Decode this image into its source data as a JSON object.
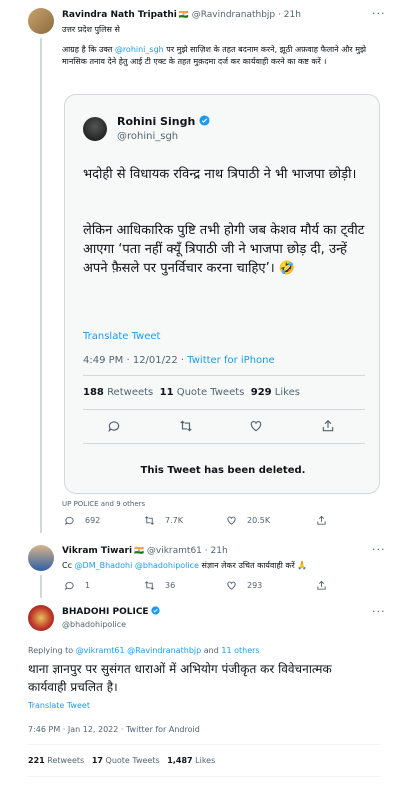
{
  "tweet1": {
    "author": "Ravindra Nath Tripathi",
    "flag": "🇮🇳",
    "handle": "@Ravindranathbjp",
    "time": "· 21h",
    "reply_to": "उत्तर प्रदेश पुलिस से",
    "body_pre": "आग्रह है कि उक्त ",
    "mention": "@rohini_sgh",
    "body_post": " पर मुझे साज़िश के तहत बदनाम करने, झूठी अफ़वाह फैलाने और मुझे मानसिक तनाव देने हेतु आई टी एक्ट के तहत मुक़दमा दर्ज कर कार्यवाही करने का कष्ट करें ।",
    "liked_by": "UP POLICE and 9 others",
    "replies": "692",
    "retweets": "7.7K",
    "likes": "20.5K"
  },
  "quoted": {
    "author": "Rohini Singh",
    "handle": "@rohini_sgh",
    "para1": "भदोही से विधायक रविन्द्र नाथ त्रिपाठी ने भी भाजपा छोड़ी।",
    "para2": "लेकिन आधिकारिक पुष्टि तभी होगी जब केशव मौर्य का ट्वीट आएगा ‘पता नहीं क्यूँ त्रिपाठी जी ने भाजपा छोड़ दी, उन्हें अपने फ़ैसले पर पुनर्विचार करना चाहिए’। 🤣",
    "translate": "Translate Tweet",
    "timestamp": "4:49 PM · 12/01/22 · ",
    "client": "Twitter for iPhone",
    "retweets_num": "188",
    "retweets_label": "Retweets",
    "quotes_num": "11",
    "quotes_label": "Quote Tweets",
    "likes_num": "929",
    "likes_label": "Likes",
    "deleted": "This Tweet has been deleted."
  },
  "tweet2": {
    "author": "Vikram Tiwari",
    "flag": "🇮🇳",
    "handle": "@vikramt61",
    "time": "· 21h",
    "body_pre": "Cc ",
    "mention1": "@DM_Bhadohi",
    "mention2": "@bhadohipolice",
    "body_post": " संज्ञान लेकर उचित कार्यवाही करें 🙏",
    "replies": "1",
    "retweets": "36",
    "likes": "293"
  },
  "main": {
    "author": "BHADOHI POLICE",
    "handle": "@bhadohipolice",
    "replying_prefix": "Replying to ",
    "replying_users": "@vikramt61 @Ravindranathbjp",
    "replying_and": " and ",
    "replying_others": "11 others",
    "body": "थाना ज्ञानपुर पर सुसंगत धाराओं में अभियोग पंजीकृत कर विवेचनात्मक कार्यवाही प्रचलित है।",
    "translate": "Translate Tweet",
    "timestamp": "7:46 PM · Jan 12, 2022 · Twitter for Android",
    "retweets_num": "221",
    "retweets_label": "Retweets",
    "quotes_num": "17",
    "quotes_label": "Quote Tweets",
    "likes_num": "1,487",
    "likes_label": "Likes"
  },
  "colors": {
    "link": "#1d9bf0",
    "verified": "#1d9bf0",
    "muted": "#536471",
    "border": "#cfd9de"
  }
}
